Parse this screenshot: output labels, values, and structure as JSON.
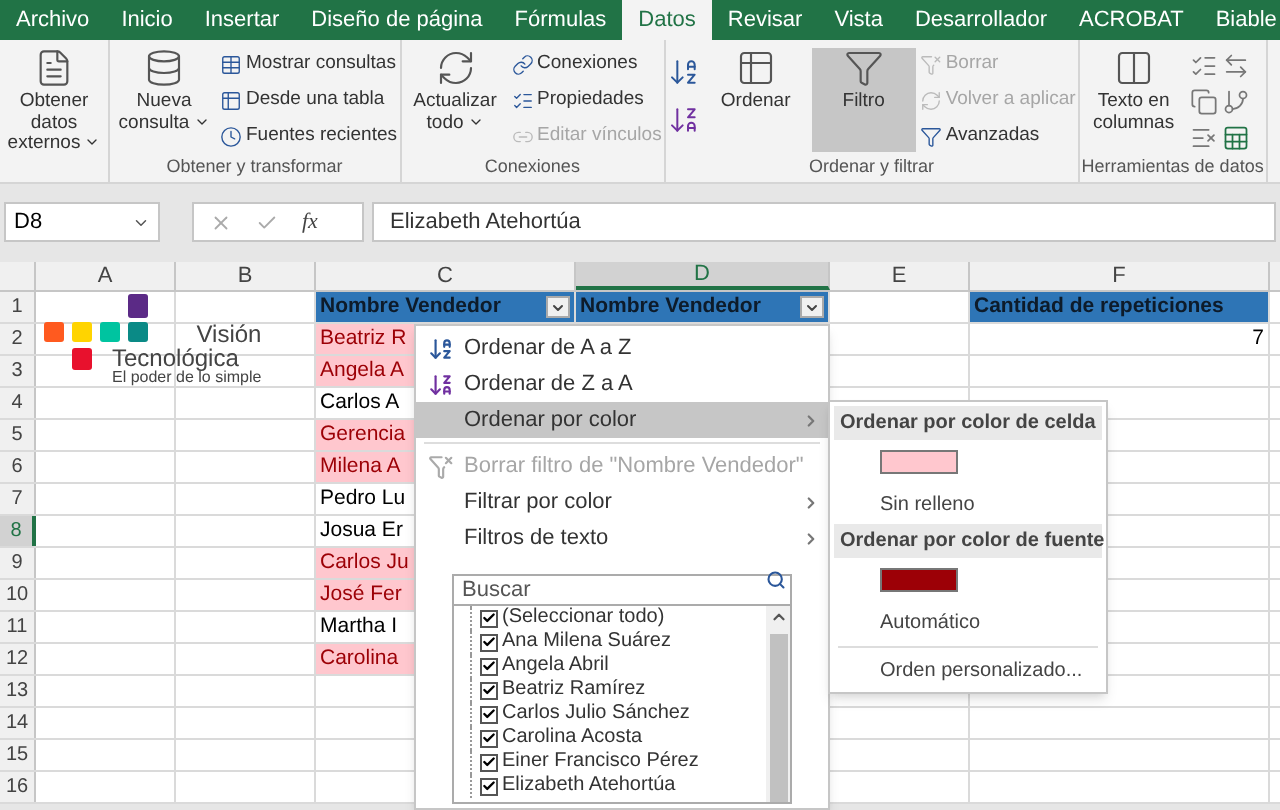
{
  "tabs": [
    {
      "label": "Archivo",
      "selected": false
    },
    {
      "label": "Inicio",
      "selected": false
    },
    {
      "label": "Insertar",
      "selected": false
    },
    {
      "label": "Diseño de página",
      "selected": false
    },
    {
      "label": "Fórmulas",
      "selected": false
    },
    {
      "label": "Datos",
      "selected": true
    },
    {
      "label": "Revisar",
      "selected": false
    },
    {
      "label": "Vista",
      "selected": false
    },
    {
      "label": "Desarrollador",
      "selected": false
    },
    {
      "label": "ACROBAT",
      "selected": false
    },
    {
      "label": "Biable",
      "selected": false
    }
  ],
  "ribbon": {
    "groups": [
      {
        "items": [
          {
            "kind": "large",
            "label": "Obtener datos externos",
            "has_menu": true,
            "selected": false
          }
        ]
      },
      {
        "label": "Obtener y transformar",
        "items": [
          {
            "kind": "large",
            "label": "Nueva consulta",
            "has_menu": true,
            "selected": false
          },
          {
            "kind": "small_stack",
            "buttons": [
              {
                "label": "Mostrar consultas",
                "disabled": false
              },
              {
                "label": "Desde una tabla",
                "disabled": false
              },
              {
                "label": "Fuentes recientes",
                "disabled": false
              }
            ]
          }
        ]
      },
      {
        "label": "Conexiones",
        "items": [
          {
            "kind": "large",
            "label": "Actualizar todo",
            "has_menu": true,
            "selected": false
          },
          {
            "kind": "small_stack",
            "buttons": [
              {
                "label": "Conexiones",
                "disabled": false
              },
              {
                "label": "Propiedades",
                "disabled": false
              },
              {
                "label": "Editar vínculos",
                "disabled": true
              }
            ]
          }
        ]
      },
      {
        "label": "Ordenar y filtrar",
        "items": [
          {
            "kind": "sort_icons"
          },
          {
            "kind": "large",
            "label": "Ordenar",
            "has_menu": false,
            "selected": false
          },
          {
            "kind": "large",
            "label": "Filtro",
            "has_menu": false,
            "selected": true
          },
          {
            "kind": "small_stack",
            "buttons": [
              {
                "label": "Borrar",
                "disabled": true
              },
              {
                "label": "Volver a aplicar",
                "disabled": true
              },
              {
                "label": "Avanzadas",
                "disabled": false
              }
            ]
          }
        ]
      },
      {
        "label": "Herramientas de datos",
        "items": [
          {
            "kind": "large",
            "label": "Texto en columnas",
            "has_menu": false,
            "selected": false
          },
          {
            "kind": "tool_icons"
          }
        ]
      }
    ]
  },
  "formula_bar": {
    "name_box": "D8",
    "fx": "fx",
    "formula": "Elizabeth Atehortúa"
  },
  "sheet": {
    "columns": [
      {
        "label": "A",
        "selected": false
      },
      {
        "label": "B",
        "selected": false
      },
      {
        "label": "C",
        "selected": false
      },
      {
        "label": "D",
        "selected": true
      },
      {
        "label": "E",
        "selected": false
      },
      {
        "label": "F",
        "selected": false
      }
    ],
    "logo": {
      "title": "Visión",
      "subtitle": "Tecnológica",
      "tagline": "El poder de lo simple"
    },
    "rows": [
      {
        "number": "1",
        "selected": false,
        "C": {
          "text": "Nombre Vendedor",
          "kind": "header",
          "filter": true
        },
        "D": {
          "text": "Nombre Vendedor",
          "kind": "header",
          "filter": true
        },
        "F": {
          "text": "Cantidad de repeticiones",
          "kind": "header",
          "filter": false
        }
      },
      {
        "number": "2",
        "selected": false,
        "C": {
          "text": "Beatriz R",
          "kind": "highlight"
        },
        "F": {
          "text": "7",
          "kind": "number"
        }
      },
      {
        "number": "3",
        "selected": false,
        "C": {
          "text": "Angela A",
          "kind": "highlight"
        }
      },
      {
        "number": "4",
        "selected": false,
        "C": {
          "text": "Carlos A",
          "kind": "plain"
        }
      },
      {
        "number": "5",
        "selected": false,
        "C": {
          "text": "Gerencia",
          "kind": "highlight"
        }
      },
      {
        "number": "6",
        "selected": false,
        "C": {
          "text": "Milena A",
          "kind": "highlight"
        }
      },
      {
        "number": "7",
        "selected": false,
        "C": {
          "text": "Pedro Lu",
          "kind": "plain"
        }
      },
      {
        "number": "8",
        "selected": true,
        "C": {
          "text": "Josua Er",
          "kind": "plain"
        }
      },
      {
        "number": "9",
        "selected": false,
        "C": {
          "text": "Carlos Ju",
          "kind": "highlight"
        }
      },
      {
        "number": "10",
        "selected": false,
        "C": {
          "text": "José Fer",
          "kind": "highlight"
        }
      },
      {
        "number": "11",
        "selected": false,
        "C": {
          "text": "Martha I",
          "kind": "plain"
        }
      },
      {
        "number": "12",
        "selected": false,
        "C": {
          "text": "Carolina",
          "kind": "highlight"
        }
      },
      {
        "number": "13",
        "selected": false
      },
      {
        "number": "14",
        "selected": false
      },
      {
        "number": "15",
        "selected": false
      },
      {
        "number": "16",
        "selected": false
      }
    ]
  },
  "filter_menu": {
    "items": [
      {
        "kind": "sort_az",
        "label": "Ordenar de A a Z",
        "highlighted": false,
        "disabled": false,
        "has_submenu": false
      },
      {
        "kind": "sort_za",
        "label": "Ordenar de Z a A",
        "highlighted": false,
        "disabled": false,
        "has_submenu": false
      },
      {
        "kind": "item",
        "label": "Ordenar por color",
        "highlighted": true,
        "disabled": false,
        "has_submenu": true
      },
      {
        "kind": "clear_filter",
        "label": "Borrar filtro de \"Nombre Vendedor\"",
        "highlighted": false,
        "disabled": true,
        "has_submenu": false
      },
      {
        "kind": "item",
        "label": "Filtrar por color",
        "highlighted": false,
        "disabled": false,
        "has_submenu": true
      },
      {
        "kind": "item",
        "label": "Filtros de texto",
        "highlighted": false,
        "disabled": false,
        "has_submenu": true
      }
    ],
    "search": {
      "placeholder": "Buscar"
    },
    "values": [
      {
        "label": "(Seleccionar todo)",
        "checked": true
      },
      {
        "label": "Ana Milena Suárez",
        "checked": true
      },
      {
        "label": "Angela Abril",
        "checked": true
      },
      {
        "label": "Beatriz Ramírez",
        "checked": true
      },
      {
        "label": "Carlos Julio Sánchez",
        "checked": true
      },
      {
        "label": "Carolina Acosta",
        "checked": true
      },
      {
        "label": "Einer Francisco Pérez",
        "checked": true
      },
      {
        "label": "Elizabeth Atehortúa",
        "checked": true
      }
    ]
  },
  "color_submenu": {
    "items": [
      {
        "kind": "header",
        "label": "Ordenar por color de celda"
      },
      {
        "kind": "swatch",
        "color": "#ffc7ce"
      },
      {
        "kind": "option",
        "label": "Sin relleno"
      },
      {
        "kind": "header",
        "label": "Ordenar por color de fuente"
      },
      {
        "kind": "swatch",
        "color": "#9c0006"
      },
      {
        "kind": "option",
        "label": "Automático"
      },
      {
        "kind": "footer",
        "label": "Orden personalizado..."
      }
    ]
  }
}
